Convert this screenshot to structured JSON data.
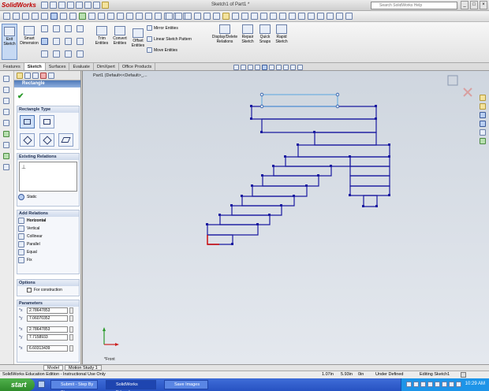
{
  "app": {
    "logo": "SolidWorks",
    "doc_title": "Sketch1 of Part1 *",
    "search_placeholder": "Search SolidWorks Help"
  },
  "window_buttons": [
    "_",
    "□",
    "×"
  ],
  "command_manager": {
    "exit_sketch": "Exit Sketch",
    "smart_dimension": "Smart Dimension",
    "trim_entities": "Trim Entities",
    "convert_entities": "Convert Entities",
    "offset_entities": "Offset Entities",
    "mirror_entities": "Mirror Entities",
    "linear_sketch_pattern": "Linear Sketch Pattern",
    "move_entities": "Move Entities",
    "display_delete_relations": "Display/Delete Relations",
    "repair_sketch": "Repair Sketch",
    "quick_snaps": "Quick Snaps",
    "rapid_sketch": "Rapid Sketch"
  },
  "tabs": [
    "Features",
    "Sketch",
    "Surfaces",
    "Evaluate",
    "DimXpert",
    "Office Products"
  ],
  "active_tab": "Sketch",
  "tree_path": "Part1  (Default<<Default>_...",
  "property_manager": {
    "title": "Rectangle",
    "rectangle_type": "Rectangle Type",
    "existing_relations": "Existing Relations",
    "static_label": "Static",
    "add_relations": "Add Relations",
    "relations": [
      "Horizontal",
      "Vertical",
      "Collinear",
      "Parallel",
      "Equal",
      "Fix"
    ],
    "options": "Options",
    "for_construction": "For construction",
    "parameters": "Parameters",
    "params": [
      "2.78647853",
      "7.06070352",
      "2.78647853",
      "7.7158933",
      "6.60313439"
    ]
  },
  "view_label": "*Front",
  "model_tabs": [
    "Model",
    "Motion Study 1"
  ],
  "status": {
    "edition": "SolidWorks Education Edition - Instructional Use Only",
    "x": "1.07in",
    "y": "5.93in",
    "z": "0in",
    "state": "Under Defined",
    "editing": "Editing Sketch1"
  },
  "taskbar": {
    "start": "start",
    "tasks": [
      "Submit - Step By Step...",
      "SolidWorks Education...",
      "Save Images"
    ],
    "clock": "10:29 AM"
  },
  "colors": {
    "sketch_line": "#1a1aa0",
    "selected_line": "#5aa7e0",
    "fixed_line": "#cc0000"
  }
}
